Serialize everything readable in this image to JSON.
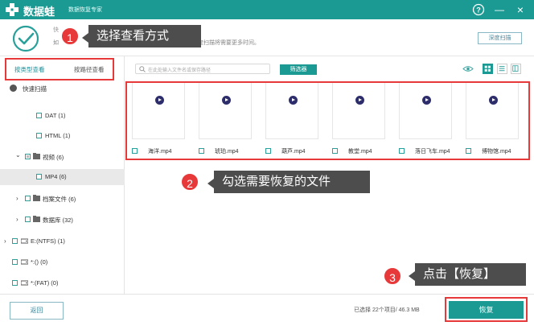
{
  "titlebar": {
    "brand": "数据蛙",
    "title": "数据恢复专家",
    "help_icon": "?",
    "minimize_icon": "—",
    "close_icon": "×"
  },
  "header": {
    "hint_line1": "快",
    "hint_line2_prefix": "如",
    "hint_line2_rest": "引深度扫描将需要更多时间。",
    "deep_scan_label": "深度扫描"
  },
  "left": {
    "tab_type": "按类型查看",
    "tab_path": "按路径查看",
    "tree": [
      {
        "label": "快速扫描",
        "indent": 0,
        "expander": "",
        "icon": ""
      },
      {
        "label": "DAT (1)",
        "indent": 2,
        "expander": "",
        "icon": ""
      },
      {
        "label": "HTML (1)",
        "indent": 2,
        "expander": "",
        "icon": ""
      },
      {
        "label": "视频 (6)",
        "indent": 1,
        "expander": "⌄",
        "icon": "folder"
      },
      {
        "label": "MP4 (6)",
        "indent": 2,
        "expander": "",
        "icon": ""
      },
      {
        "label": "档案文件 (6)",
        "indent": 1,
        "expander": "›",
        "icon": "folder"
      },
      {
        "label": "数据库 (32)",
        "indent": 1,
        "expander": "›",
        "icon": "folder"
      },
      {
        "label": "E:(NTFS) (1)",
        "indent": 0,
        "expander": "›",
        "icon": "drive"
      },
      {
        "label": "*:() (0)",
        "indent": 0,
        "expander": "",
        "icon": "drive"
      },
      {
        "label": "*:(FAT) (0)",
        "indent": 0,
        "expander": "",
        "icon": "drive"
      }
    ]
  },
  "toolbar": {
    "search_placeholder": "在此处输入文件名或保存路径",
    "filter_label": "筛选器"
  },
  "files": [
    {
      "name": "海洋.mp4"
    },
    {
      "name": "琥珀.mp4"
    },
    {
      "name": "葫芦.mp4"
    },
    {
      "name": "教堂.mp4"
    },
    {
      "name": "落日飞车.mp4"
    },
    {
      "name": "博物馆.mp4"
    }
  ],
  "bottom": {
    "back_label": "返回",
    "status": "已选择 22个项目/ 46.3 MB",
    "recover_label": "恢复"
  },
  "annotations": [
    {
      "number": "1",
      "text": "选择查看方式"
    },
    {
      "number": "2",
      "text": "勾选需要恢复的文件"
    },
    {
      "number": "3",
      "text": "点击【恢复】"
    }
  ],
  "colors": {
    "brand": "#1a9a93",
    "annotation_red": "#e8393a",
    "callout_bg": "#4d4d4d"
  }
}
